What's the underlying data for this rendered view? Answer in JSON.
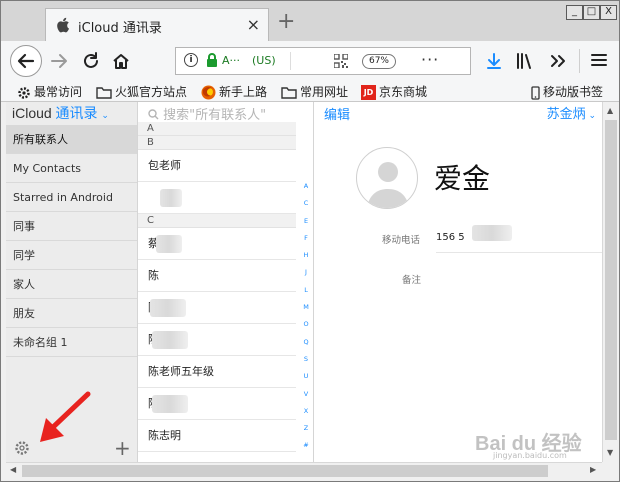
{
  "window": {
    "tab_title": "iCloud 通讯录",
    "minimize": "_",
    "restore": "□",
    "close": "X"
  },
  "toolbar": {
    "url_host": "A···",
    "url_region": "(US)",
    "zoom": "67%",
    "more": "···"
  },
  "bookmarks": [
    {
      "label": "最常访问",
      "icon": "gear-icon"
    },
    {
      "label": "火狐官方站点",
      "icon": "folder-icon"
    },
    {
      "label": "新手上路",
      "icon": "firefox-icon"
    },
    {
      "label": "常用网址",
      "icon": "folder-icon"
    },
    {
      "label": "京东商城",
      "icon": "jd-icon"
    },
    {
      "label": "移动版书签",
      "icon": "mobile-icon"
    }
  ],
  "sidebar": {
    "brand": "iCloud",
    "app_name": "通讯录",
    "groups": [
      {
        "label": "所有联系人",
        "selected": true
      },
      {
        "label": "My Contacts"
      },
      {
        "label": "Starred in Android"
      },
      {
        "label": "同事"
      },
      {
        "label": "同学"
      },
      {
        "label": "家人"
      },
      {
        "label": "朋友"
      },
      {
        "label": "未命名组 1"
      }
    ]
  },
  "list": {
    "search_placeholder": "搜索\"所有联系人\"",
    "sections": [
      {
        "letter": "A"
      },
      {
        "letter": "B"
      },
      {
        "letter": "C"
      }
    ],
    "rows": [
      {
        "name": "包老师"
      },
      {
        "name": ""
      },
      {
        "name": "蔡"
      },
      {
        "name": "陈"
      },
      {
        "name": "陈"
      },
      {
        "name": "陈"
      },
      {
        "name": "陈老师五年级"
      },
      {
        "name": "陈"
      },
      {
        "name": "陈志明"
      }
    ],
    "alphabet": [
      "A",
      "C",
      "E",
      "F",
      "H",
      "J",
      "L",
      "M",
      "O",
      "Q",
      "S",
      "U",
      "V",
      "X",
      "Z",
      "#"
    ]
  },
  "detail": {
    "edit": "编辑",
    "account": "苏金炳",
    "name": "爱金",
    "fields": [
      {
        "label": "移动电话",
        "value": "156 5"
      },
      {
        "label": "备注",
        "value": ""
      }
    ]
  },
  "watermark": {
    "text": "Bai du 经验",
    "sub": "jingyan.baidu.com"
  },
  "colors": {
    "accent": "#1a8cff",
    "annotation_arrow": "#e8231f"
  }
}
